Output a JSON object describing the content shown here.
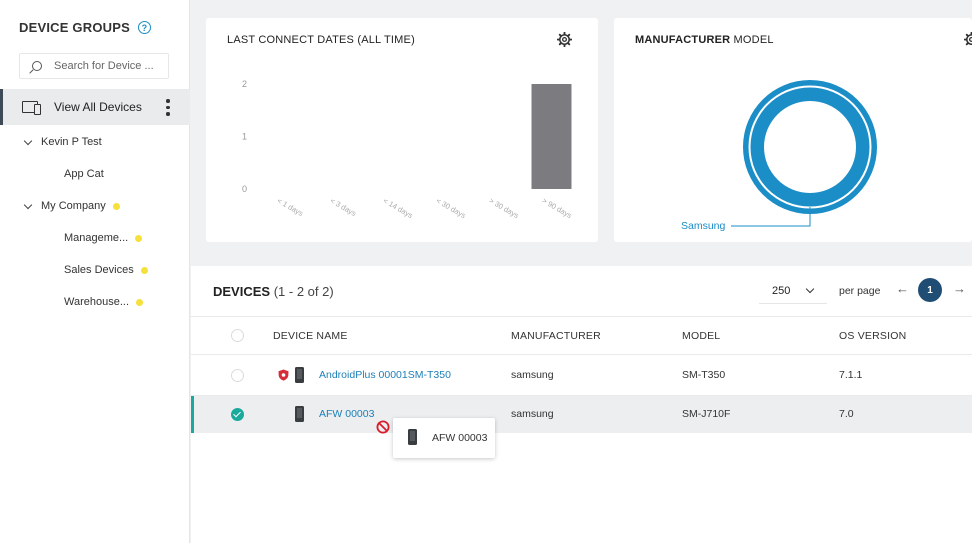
{
  "sidebar": {
    "title": "DEVICE GROUPS",
    "help_icon": "question-circle-icon",
    "search_placeholder": "Search for Device ...",
    "view_all": "View All Devices",
    "tree": [
      {
        "label": "Kevin P Test",
        "expanded": true,
        "level": 0,
        "dot": false
      },
      {
        "label": "App Cat",
        "level": 1,
        "dot": false
      },
      {
        "label": "My Company",
        "expanded": true,
        "level": 0,
        "dot": true
      },
      {
        "label": "Manageme...",
        "level": 1,
        "dot": true
      },
      {
        "label": "Sales Devices",
        "level": 1,
        "dot": true
      },
      {
        "label": "Warehouse...",
        "level": 1,
        "dot": true
      }
    ],
    "dot_color": "#f6e03b"
  },
  "chart_card": {
    "title": "LAST CONNECT DATES (ALL TIME)",
    "gear_icon": "gear-icon"
  },
  "chart_data": [
    {
      "type": "bar",
      "title": "LAST CONNECT DATES (ALL TIME)",
      "categories": [
        "< 1 days",
        "< 3 days",
        "< 14 days",
        "< 30 days",
        "> 30 days",
        "> 90 days"
      ],
      "values": [
        0,
        0,
        0,
        0,
        0,
        2
      ],
      "y_ticks": [
        "2",
        "1",
        "0"
      ],
      "ylim": [
        0,
        2
      ],
      "bar_color": "#7c7b80",
      "grid": false
    },
    {
      "type": "pie",
      "title": "MANUFACTURER MODEL",
      "categories": [
        "Samsung"
      ],
      "values": [
        2
      ],
      "colors": [
        "#1b8dc7"
      ]
    }
  ],
  "manufacturer_card": {
    "title_bold": "MANUFACTURER",
    "title_rest": " MODEL",
    "label": "Samsung",
    "ring_color": "#1b8dc7"
  },
  "devices": {
    "title": "DEVICES",
    "count": "(1 - 2 of 2)",
    "per_page_value": "250",
    "per_page_label": "per page",
    "prev_icon": "←",
    "next_icon": "→",
    "current_page": "1",
    "columns": [
      "DEVICE NAME",
      "MANUFACTURER",
      "MODEL",
      "OS VERSION"
    ],
    "rows": [
      {
        "name": "AndroidPlus 00001SM-T350",
        "manufacturer": "samsung",
        "model": "SM-T350",
        "os": "7.1.1",
        "selected": false
      },
      {
        "name": "AFW 00003",
        "manufacturer": "samsung",
        "model": "SM-J710F",
        "os": "7.0",
        "selected": true
      }
    ],
    "accent_color": "#1aa99a",
    "link_color": "#1d7fb8"
  },
  "drag_ghost": {
    "label": "AFW 00003"
  }
}
